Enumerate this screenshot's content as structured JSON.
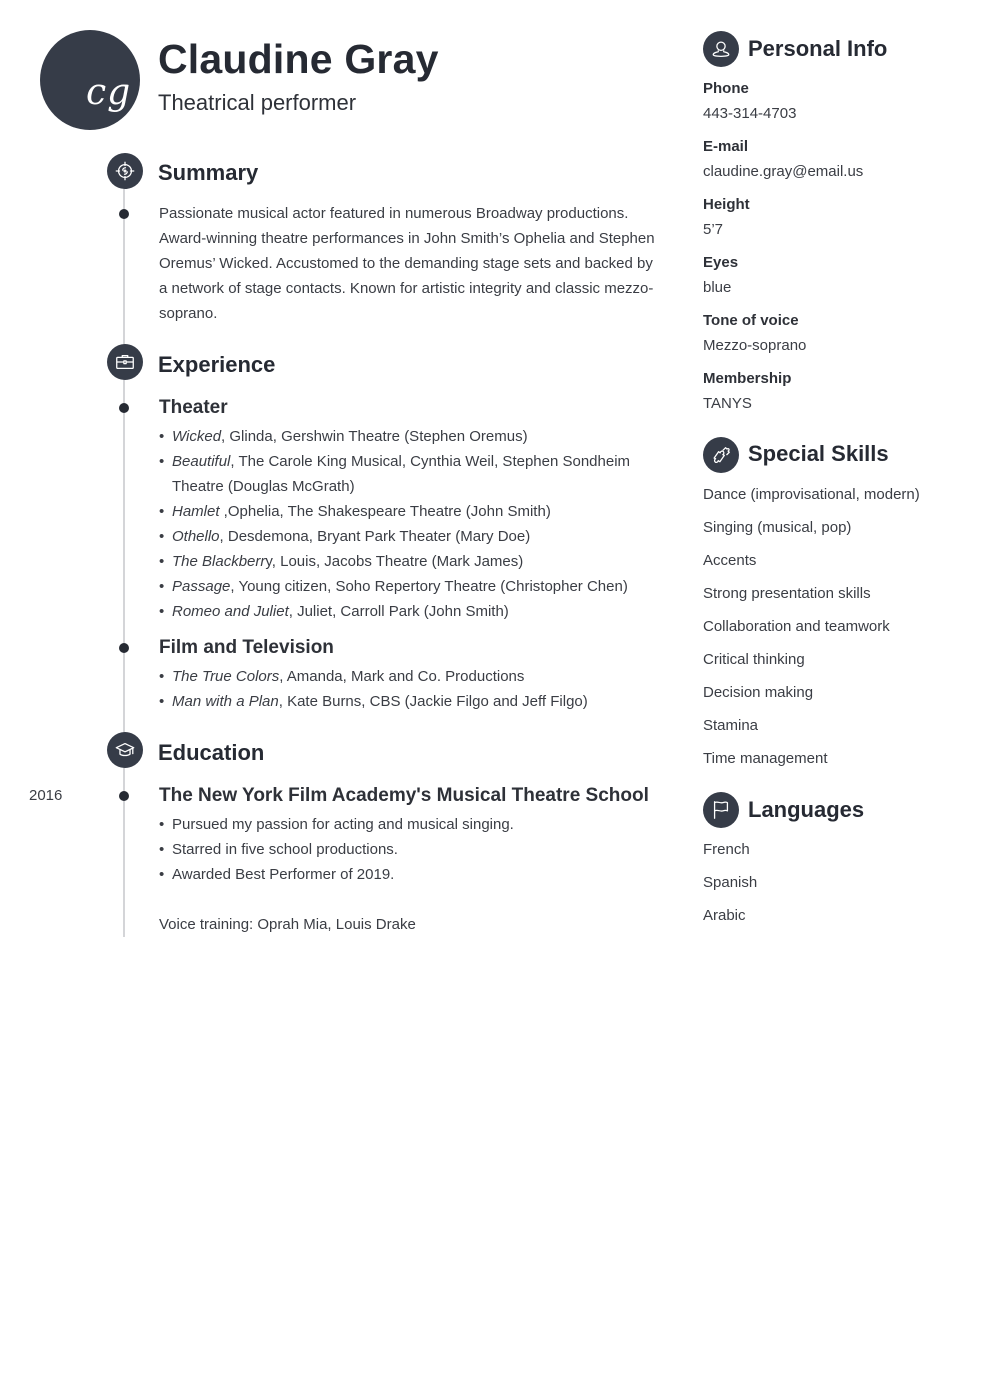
{
  "header": {
    "initials": "cg",
    "name": "Claudine Gray",
    "title": "Theatrical performer"
  },
  "summary": {
    "title": "Summary",
    "icon": "target-icon",
    "text": "Passionate musical actor featured in numerous Broadway productions. Award-winning theatre performances in John Smith’s Ophelia and Stephen Oremus’ Wicked. Accustomed to the demanding stage sets and backed by a network of stage contacts. Known for artistic integrity and classic mezzo-soprano."
  },
  "experience": {
    "title": "Experience",
    "icon": "briefcase-icon",
    "groups": [
      {
        "title": "Theater",
        "items": [
          {
            "work": "Wicked",
            "rest": ", Glinda, Gershwin Theatre (Stephen Oremus)"
          },
          {
            "work": "Beautiful",
            "rest": ", The Carole King Musical, Cynthia Weil, Stephen Sondheim Theatre (Douglas McGrath)"
          },
          {
            "work": "Hamlet",
            "rest": " ,Ophelia, The Shakespeare Theatre (John Smith)"
          },
          {
            "work": "Othello",
            "rest": ", Desdemona, Bryant Park Theater (Mary Doe)"
          },
          {
            "work": "The Blackberr",
            "rest": "y, Louis, Jacobs Theatre (Mark James)"
          },
          {
            "work": "Passage",
            "rest": ", Young citizen, Soho Repertory Theatre (Christopher Chen)"
          },
          {
            "work": "Romeo and Juliet",
            "rest": ", Juliet, Carroll Park (John Smith)"
          }
        ]
      },
      {
        "title": "Film and Television",
        "items": [
          {
            "work": "The True Colors",
            "rest": ", Amanda, Mark and Co. Productions"
          },
          {
            "work": "Man with a Plan",
            "rest": ", Kate Burns, CBS (Jackie Filgo and Jeff Filgo)"
          }
        ]
      }
    ]
  },
  "education": {
    "title": "Education",
    "icon": "graduation-cap-icon",
    "year": "2016",
    "school": "The New York Film Academy's Musical Theatre School",
    "bullets": [
      "Pursued my passion for acting and musical singing.",
      "Starred in five school productions.",
      "Awarded Best Performer of 2019."
    ],
    "note": "Voice training: Oprah Mia, Louis Drake"
  },
  "personal_info": {
    "title": "Personal Info",
    "icon": "person-icon",
    "fields": [
      {
        "label": "Phone",
        "value": "443-314-4703"
      },
      {
        "label": "E-mail",
        "value": "claudine.gray@email.us"
      },
      {
        "label": "Height",
        "value": "5’7"
      },
      {
        "label": "Eyes",
        "value": "blue"
      },
      {
        "label": "Tone of voice",
        "value": "Mezzo-soprano"
      },
      {
        "label": "Membership",
        "value": "TANYS"
      }
    ]
  },
  "skills": {
    "title": "Special Skills",
    "icon": "puzzle-icon",
    "items": [
      "Dance (improvisational, modern)",
      "Singing (musical, pop)",
      "Accents",
      "Strong presentation skills",
      "Collaboration and teamwork",
      "Critical thinking",
      "Decision making",
      "Stamina",
      "Time management"
    ]
  },
  "languages": {
    "title": "Languages",
    "icon": "flag-icon",
    "items": [
      "French",
      "Spanish",
      "Arabic"
    ]
  }
}
